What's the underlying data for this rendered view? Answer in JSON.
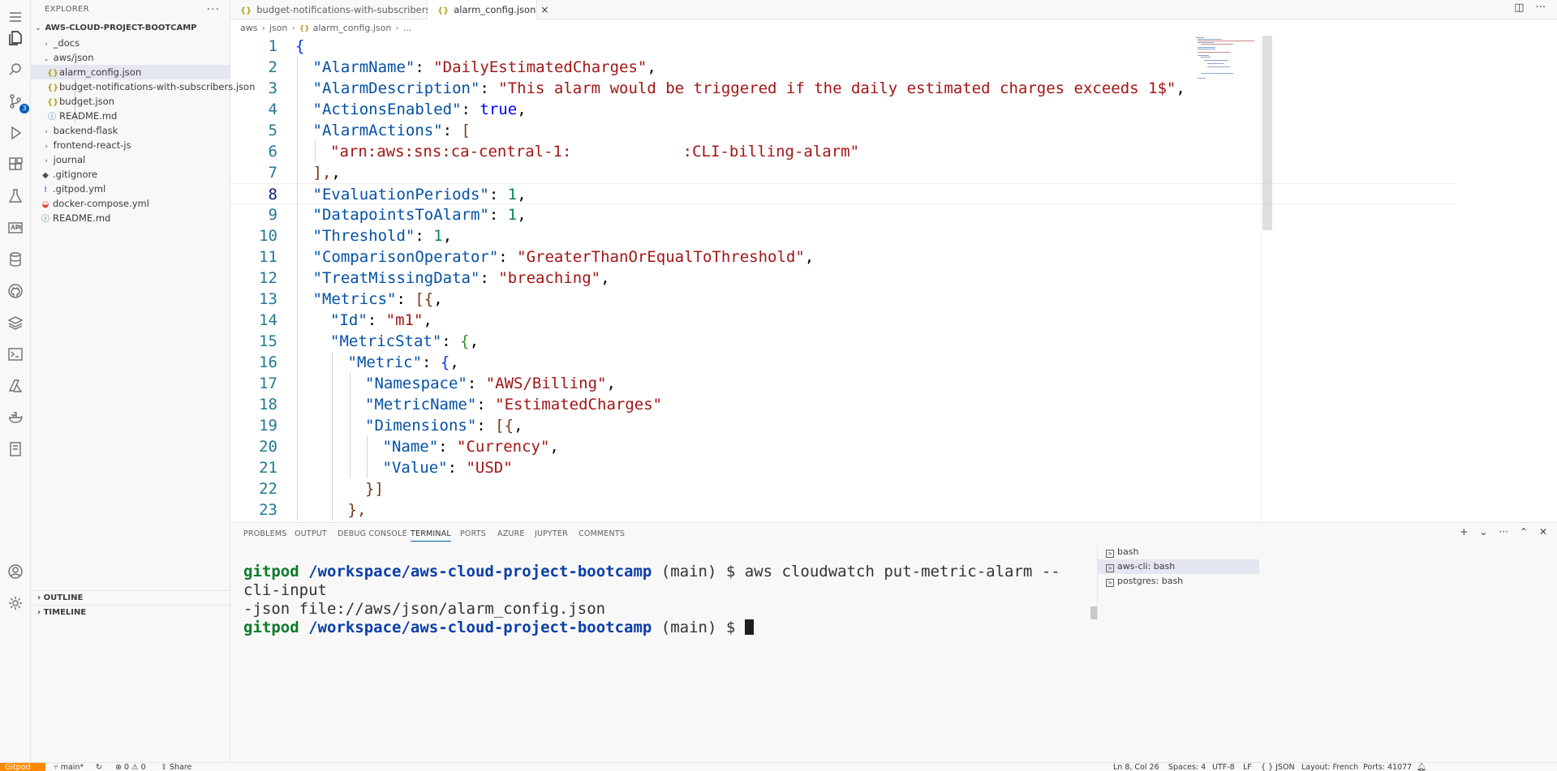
{
  "sidebar": {
    "title": "EXPLORER",
    "more": "···",
    "root": "AWS-CLOUD-PROJECT-BOOTCAMP",
    "items": [
      {
        "label": "_docs"
      },
      {
        "label": "aws/json"
      },
      {
        "label": "alarm_config.json"
      },
      {
        "label": "budget-notifications-with-subscribers.json"
      },
      {
        "label": "budget.json"
      },
      {
        "label": "README.md"
      },
      {
        "label": "backend-flask"
      },
      {
        "label": "frontend-react-js"
      },
      {
        "label": "journal"
      },
      {
        "label": ".gitignore"
      },
      {
        "label": ".gitpod.yml"
      },
      {
        "label": "docker-compose.yml"
      },
      {
        "label": "README.md"
      }
    ],
    "outline": "OUTLINE",
    "timeline": "TIMELINE"
  },
  "activity": {
    "scm_badge": "3"
  },
  "tabs": [
    {
      "label": "budget-notifications-with-subscribers.json"
    },
    {
      "label": "alarm_config.json",
      "close": "×"
    }
  ],
  "breadcrumb": {
    "part1": "aws",
    "part2": "json",
    "part3": "alarm_config.json",
    "part4": "..."
  },
  "editor": {
    "line_numbers": [
      "1",
      "2",
      "3",
      "4",
      "5",
      "6",
      "7",
      "8",
      "9",
      "10",
      "11",
      "12",
      "13",
      "14",
      "15",
      "16",
      "17",
      "18",
      "19",
      "20",
      "21",
      "22",
      "23"
    ],
    "lines": [
      {
        "key": "",
        "val": "{"
      },
      {
        "key": "\"AlarmName\"",
        "val": "\"DailyEstimatedCharges\""
      },
      {
        "key": "\"AlarmDescription\"",
        "val": "\"This alarm would be triggered if the daily estimated charges exceeds 1$\""
      },
      {
        "key": "\"ActionsEnabled\"",
        "val": "true"
      },
      {
        "key": "\"AlarmActions\"",
        "val": "["
      },
      {
        "key": "",
        "val": "\"arn:aws:sns:ca-central-1:            :CLI-billing-alarm\""
      },
      {
        "key": "",
        "val": "],"
      },
      {
        "key": "\"EvaluationPeriods\"",
        "val": "1"
      },
      {
        "key": "\"DatapointsToAlarm\"",
        "val": "1"
      },
      {
        "key": "\"Threshold\"",
        "val": "1"
      },
      {
        "key": "\"ComparisonOperator\"",
        "val": "\"GreaterThanOrEqualToThreshold\""
      },
      {
        "key": "\"TreatMissingData\"",
        "val": "\"breaching\""
      },
      {
        "key": "\"Metrics\"",
        "val": "[{"
      },
      {
        "key": "\"Id\"",
        "val": "\"m1\""
      },
      {
        "key": "\"MetricStat\"",
        "val": "{"
      },
      {
        "key": "\"Metric\"",
        "val": "{"
      },
      {
        "key": "\"Namespace\"",
        "val": "\"AWS/Billing\""
      },
      {
        "key": "\"MetricName\"",
        "val": "\"EstimatedCharges\""
      },
      {
        "key": "\"Dimensions\"",
        "val": "[{"
      },
      {
        "key": "\"Name\"",
        "val": "\"Currency\""
      },
      {
        "key": "\"Value\"",
        "val": "\"USD\""
      },
      {
        "key": "",
        "val": "}]"
      },
      {
        "key": "",
        "val": "},"
      }
    ]
  },
  "panel": {
    "tabs": [
      "PROBLEMS",
      "OUTPUT",
      "DEBUG CONSOLE",
      "TERMINAL",
      "PORTS",
      "AZURE",
      "JUPYTER",
      "COMMENTS"
    ],
    "terminal": {
      "prompt_user": "gitpod",
      "prompt_path": "/workspace/aws-cloud-project-bootcamp",
      "prompt_branch": "(main) $",
      "command_line1": "aws cloudwatch put-metric-alarm --cli-input",
      "command_line2": "-json file://aws/json/alarm_config.json"
    },
    "terminals": [
      "bash",
      "aws-cli: bash",
      "postgres: bash"
    ]
  },
  "status": {
    "remote": "Gitpod",
    "branch": "main*",
    "problems": "⊗ 0 ⚠ 0",
    "share": "Share",
    "position": "Ln 8, Col 26",
    "spaces": "Spaces: 4",
    "encoding": "UTF-8",
    "eol": "LF",
    "language": "{ } JSON",
    "layout": "Layout: French",
    "ports": "Ports: 41077"
  },
  "colors": {
    "accent": "#005fb8",
    "remote": "#ff8a00",
    "string": "#a31515",
    "key": "#0451a5",
    "number": "#098658",
    "keyword": "#0000ff"
  }
}
